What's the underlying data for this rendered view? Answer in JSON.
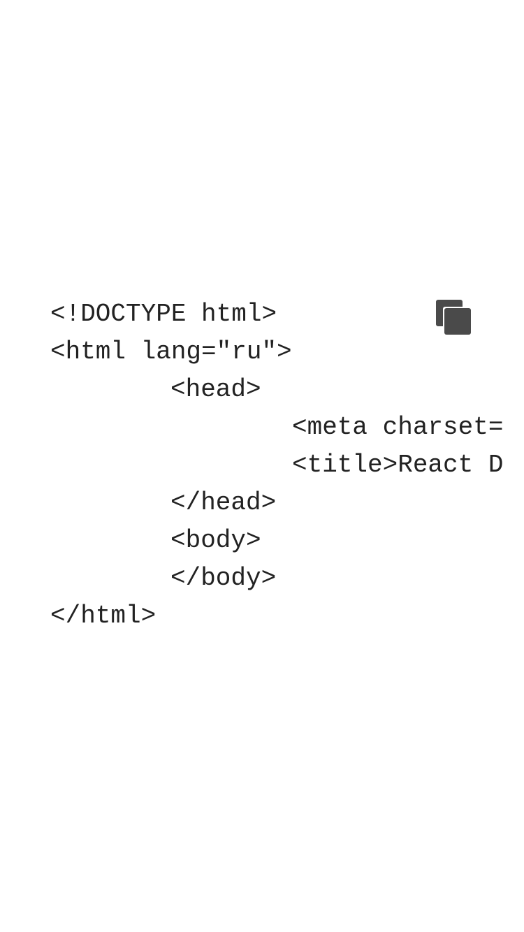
{
  "code": {
    "lines": [
      "<!DOCTYPE html>",
      "<html lang=\"ru\">",
      "<head>",
      "<meta charset=",
      "<title>React D",
      "</head>",
      "<body>",
      "</body>",
      "</html>"
    ]
  },
  "copy_button": {
    "icon": "copy-icon"
  }
}
